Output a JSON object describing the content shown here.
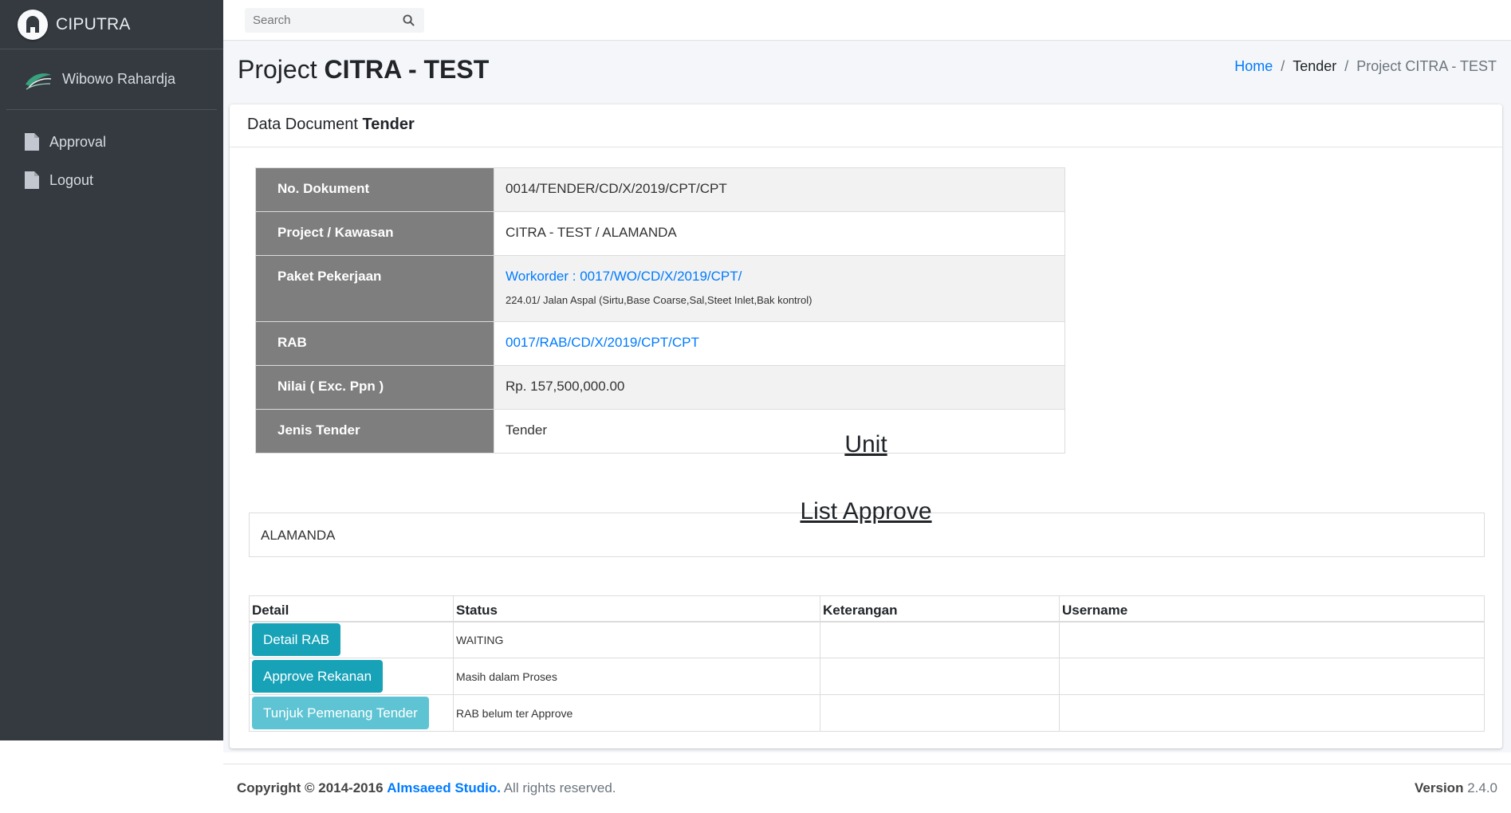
{
  "brand": {
    "name": "CIPUTRA"
  },
  "user": {
    "name": "Wibowo Rahardja"
  },
  "nav": [
    {
      "label": "Approval"
    },
    {
      "label": "Logout"
    }
  ],
  "search": {
    "placeholder": "Search"
  },
  "page": {
    "title_prefix": "Project",
    "title_bold": "CITRA - TEST"
  },
  "breadcrumb": {
    "home": "Home",
    "sep": "/",
    "tender": "Tender",
    "current": "Project CITRA - TEST"
  },
  "card": {
    "header_prefix": "Data Document",
    "header_bold": "Tender"
  },
  "doc": {
    "no_dokument_label": "No. Dokument",
    "no_dokument": "0014/TENDER/CD/X/2019/CPT/CPT",
    "project_label": "Project / Kawasan",
    "project": "CITRA - TEST / ALAMANDA",
    "paket_label": "Paket Pekerjaan",
    "paket_link": "Workorder : 0017/WO/CD/X/2019/CPT/",
    "paket_detail": "224.01/ Jalan Aspal (Sirtu,Base Coarse,Sal,Steet Inlet,Bak kontrol)",
    "rab_label": "RAB",
    "rab": "0017/RAB/CD/X/2019/CPT/CPT",
    "nilai_label": "Nilai ( Exc. Ppn )",
    "nilai": "Rp. 157,500,000.00",
    "jenis_label": "Jenis Tender",
    "jenis": "Tender"
  },
  "unit": {
    "title": "Unit",
    "value": "ALAMANDA"
  },
  "approve": {
    "title": "List Approve",
    "headers": [
      "Detail",
      "Status",
      "Keterangan",
      "Username"
    ],
    "rows": [
      {
        "button": "Detail RAB",
        "status": "WAITING",
        "keterangan": "",
        "username": ""
      },
      {
        "button": "Approve Rekanan",
        "status": "Masih dalam Proses",
        "keterangan": "",
        "username": ""
      },
      {
        "button": "Tunjuk Pemenang Tender",
        "status": "RAB belum ter Approve",
        "keterangan": "",
        "username": ""
      }
    ]
  },
  "footer": {
    "copyright": "Copyright © 2014-2016",
    "studio": "Almsaeed Studio.",
    "rights": "All rights reserved.",
    "version_label": "Version",
    "version": "2.4.0"
  },
  "colors": {
    "sidebar": "#343a40",
    "accent": "#17a2b8",
    "link": "#007bff",
    "label_bg": "#7e7e7e"
  }
}
